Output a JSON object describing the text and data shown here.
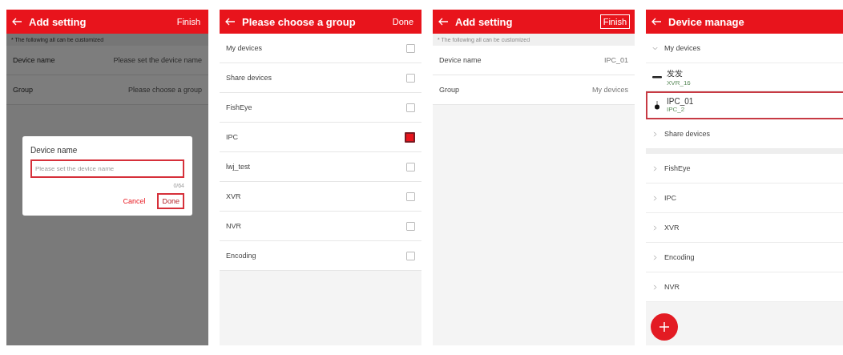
{
  "screens": [
    {
      "kind": "form",
      "title": "Add setting",
      "action": {
        "label": "Finish",
        "highlighted": false
      },
      "dimmed": true,
      "hint": "* The following all can be customized",
      "fields": [
        {
          "label": "Device name",
          "placeholder": "Please set the device name"
        },
        {
          "label": "Group",
          "placeholder": "Please choose a group"
        }
      ],
      "dialog": {
        "title": "Device name",
        "input": {
          "placeholder": "Please set the device name",
          "highlighted": true
        },
        "counter": "0/64",
        "buttons": [
          {
            "label": "Cancel",
            "highlighted": false
          },
          {
            "label": "Done",
            "highlighted": true
          }
        ]
      }
    },
    {
      "kind": "picker",
      "title": "Please choose a group",
      "action": {
        "label": "Done",
        "highlighted": false
      },
      "items": [
        {
          "label": "My devices",
          "checked": false
        },
        {
          "label": "Share devices",
          "checked": false
        },
        {
          "label": "FishEye",
          "checked": false
        },
        {
          "label": "IPC",
          "checked": true
        },
        {
          "label": "lwj_test",
          "checked": false
        },
        {
          "label": "XVR",
          "checked": false
        },
        {
          "label": "NVR",
          "checked": false
        },
        {
          "label": "Encoding",
          "checked": false
        }
      ]
    },
    {
      "kind": "form",
      "title": "Add setting",
      "action": {
        "label": "Finish",
        "highlighted": true
      },
      "dimmed": false,
      "hint": "* The following all can be customized",
      "fields": [
        {
          "label": "Device name",
          "value": "IPC_01"
        },
        {
          "label": "Group",
          "value": "My devices"
        }
      ]
    },
    {
      "kind": "devices",
      "title": "Device manage",
      "groups": [
        {
          "label": "My devices",
          "expanded": true,
          "children": [
            {
              "name": "发发",
              "sub": "XVR_16",
              "kind": "dvr",
              "highlighted": false
            },
            {
              "name": "IPC_01",
              "sub": "IPC_2",
              "kind": "camera",
              "highlighted": true
            }
          ]
        },
        {
          "label": "Share devices",
          "expanded": false
        },
        {
          "label": "FishEye",
          "expanded": false
        },
        {
          "label": "IPC",
          "expanded": false
        },
        {
          "label": "XVR",
          "expanded": false
        },
        {
          "label": "Encoding",
          "expanded": false
        },
        {
          "label": "NVR",
          "expanded": false
        }
      ]
    }
  ]
}
